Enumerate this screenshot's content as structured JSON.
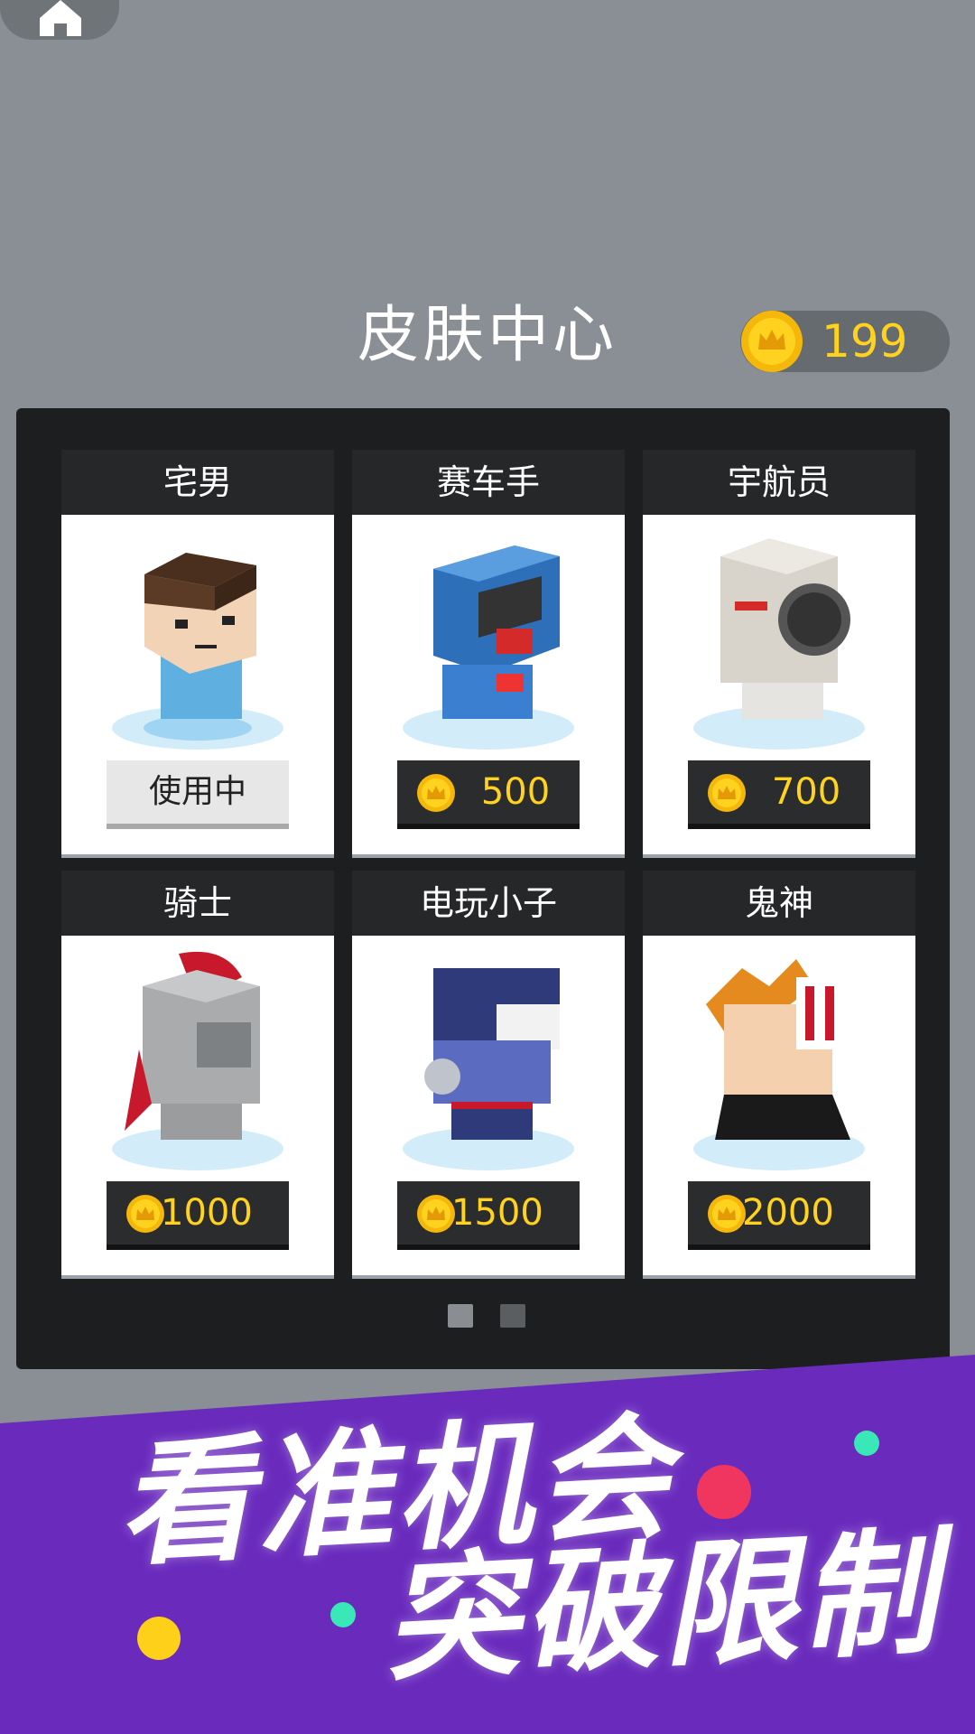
{
  "header": {
    "title": "皮肤中心",
    "coin_balance": "199"
  },
  "skins": [
    {
      "name": "宅男",
      "status": "使用中"
    },
    {
      "name": "赛车手",
      "price": "500"
    },
    {
      "name": "宇航员",
      "price": "700"
    },
    {
      "name": "骑士",
      "price": "1000"
    },
    {
      "name": "电玩小子",
      "price": "1500"
    },
    {
      "name": "鬼神",
      "price": "2000"
    }
  ],
  "pagination": {
    "pages": 2,
    "current": 1
  },
  "banner": {
    "line1": "看准机会",
    "line2": "突破限制"
  },
  "colors": {
    "background": "#898f94",
    "panel": "#1d1e20",
    "accent_gold": "#ffd21f",
    "banner_purple": "#6a2bbd"
  },
  "icons": [
    "home-icon",
    "coin-icon",
    "crown-icon"
  ]
}
